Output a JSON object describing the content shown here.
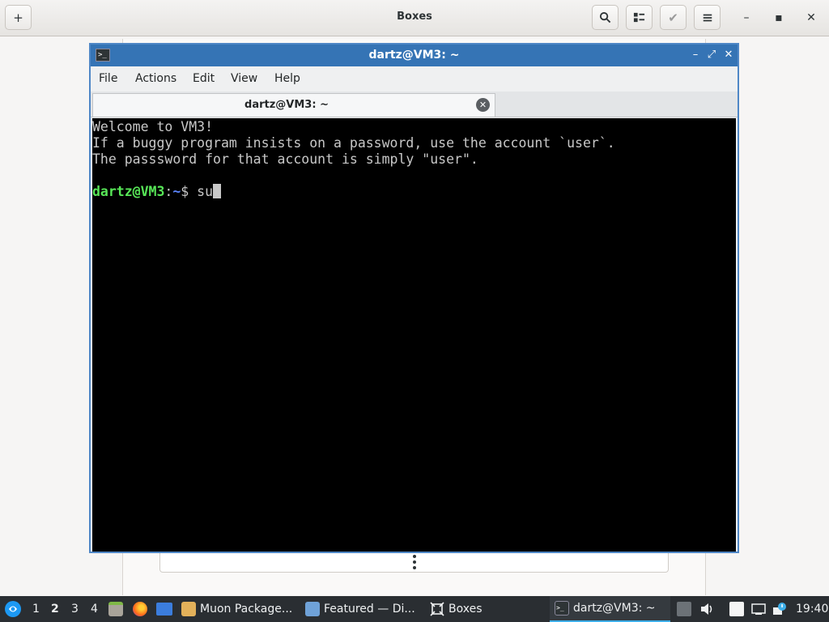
{
  "boxes": {
    "title": "Boxes",
    "buttons": {
      "new": "+",
      "search": "⚲",
      "view": "☷",
      "select": "✔",
      "menu": "≡",
      "minimize": "–",
      "maximize": "▪",
      "close": "✕"
    }
  },
  "terminal": {
    "window_title": "dartz@VM3: ~",
    "menu": [
      "File",
      "Actions",
      "Edit",
      "View",
      "Help"
    ],
    "tab_label": "dartz@VM3: ~",
    "tab_close": "✕",
    "controls": {
      "minimize": "–",
      "maximize": "⤢",
      "close": "✕"
    },
    "lines": [
      "Welcome to VM3!",
      "If a buggy program insists on a password, use the account `user`.",
      "The passsword for that account is simply \"user\"."
    ],
    "prompt_user": "dartz@VM3",
    "prompt_sep": ":",
    "prompt_path": "~",
    "prompt_symbol": "$ ",
    "command": "su"
  },
  "taskbar": {
    "workspaces": [
      "1",
      "2",
      "3",
      "4"
    ],
    "active_workspace": "2",
    "tasks": [
      {
        "label": "Muon Package..."
      },
      {
        "label": "Featured — Di..."
      },
      {
        "label": "Boxes"
      },
      {
        "label": "dartz@VM3: ~"
      }
    ],
    "clock": "19:40"
  },
  "colors": {
    "terminal_titlebar": "#3574b5",
    "prompt_user": "#57e657",
    "prompt_path": "#5c86ff",
    "taskbar_bg": "#2a2e32",
    "active_task_underline": "#3daee9"
  }
}
